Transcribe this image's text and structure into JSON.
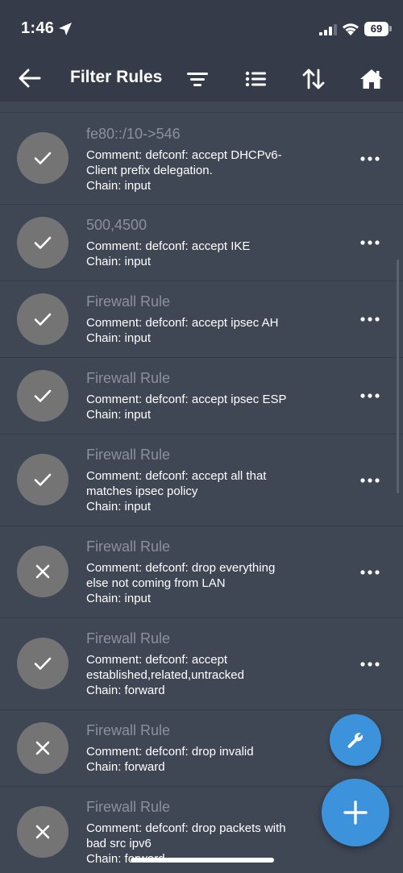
{
  "status_bar": {
    "time": "1:46",
    "battery": "69"
  },
  "app_bar": {
    "title": "Filter Rules"
  },
  "rules": [
    {
      "title": "fe80::/10->546",
      "comment": "Comment: defconf: accept DHCPv6-",
      "comment2": "Client prefix delegation.",
      "chain": "Chain: input",
      "enabled": true
    },
    {
      "title": "500,4500",
      "comment": "Comment: defconf: accept IKE",
      "comment2": "",
      "chain": "Chain: input",
      "enabled": true
    },
    {
      "title": "Firewall Rule",
      "comment": "Comment: defconf: accept ipsec AH",
      "comment2": "",
      "chain": "Chain: input",
      "enabled": true
    },
    {
      "title": "Firewall Rule",
      "comment": "Comment: defconf: accept ipsec ESP",
      "comment2": "",
      "chain": "Chain: input",
      "enabled": true
    },
    {
      "title": "Firewall Rule",
      "comment": "Comment: defconf: accept all that",
      "comment2": "matches ipsec policy",
      "chain": "Chain: input",
      "enabled": true
    },
    {
      "title": "Firewall Rule",
      "comment": "Comment: defconf: drop everything",
      "comment2": "else not coming from LAN",
      "chain": "Chain: input",
      "enabled": false
    },
    {
      "title": "Firewall Rule",
      "comment": "Comment: defconf: accept",
      "comment2": "established,related,untracked",
      "chain": "Chain: forward",
      "enabled": true
    },
    {
      "title": "Firewall Rule",
      "comment": "Comment: defconf: drop invalid",
      "comment2": "",
      "chain": "Chain: forward",
      "enabled": false
    },
    {
      "title": "Firewall Rule",
      "comment": "Comment: defconf: drop packets with",
      "comment2": "bad src ipv6",
      "chain": "Chain: forward",
      "enabled": false
    }
  ],
  "colors": {
    "background": "#353b48",
    "list": "#3f4654",
    "accent": "#3c92db",
    "status_circle": "#747474"
  },
  "icons": {
    "app_bar": [
      "back-arrow-icon",
      "filter-icon",
      "list-icon",
      "sort-icon",
      "home-icon"
    ],
    "fabs": [
      "wrench-icon",
      "plus-icon"
    ]
  }
}
